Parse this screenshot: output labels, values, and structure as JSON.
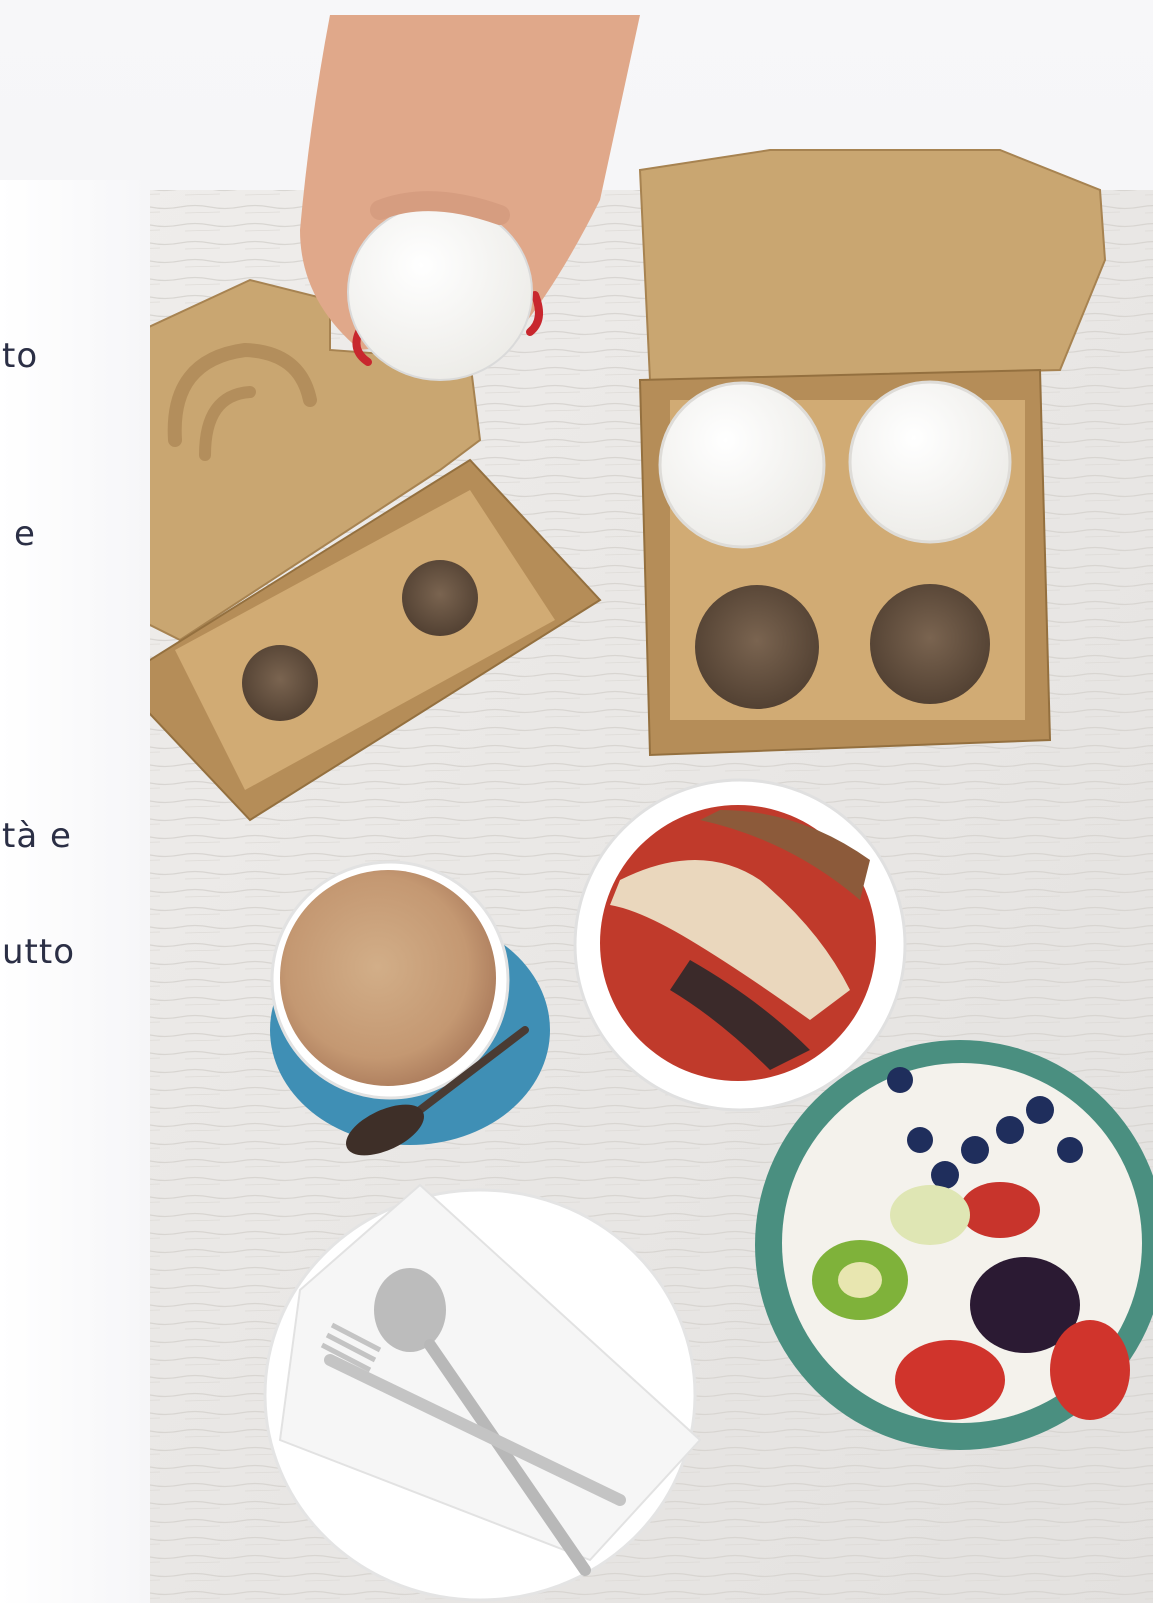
{
  "text_fragments": [
    "to",
    "e",
    "tà e",
    "utto"
  ],
  "colors": {
    "page_background": "#f4f4f6",
    "wood_table": "#eae8e6",
    "kraft_cardboard": "#c8a370",
    "text": "#2b2f45",
    "saucer_blue": "#3f8fb5",
    "bowl_green": "#4a8f80"
  }
}
